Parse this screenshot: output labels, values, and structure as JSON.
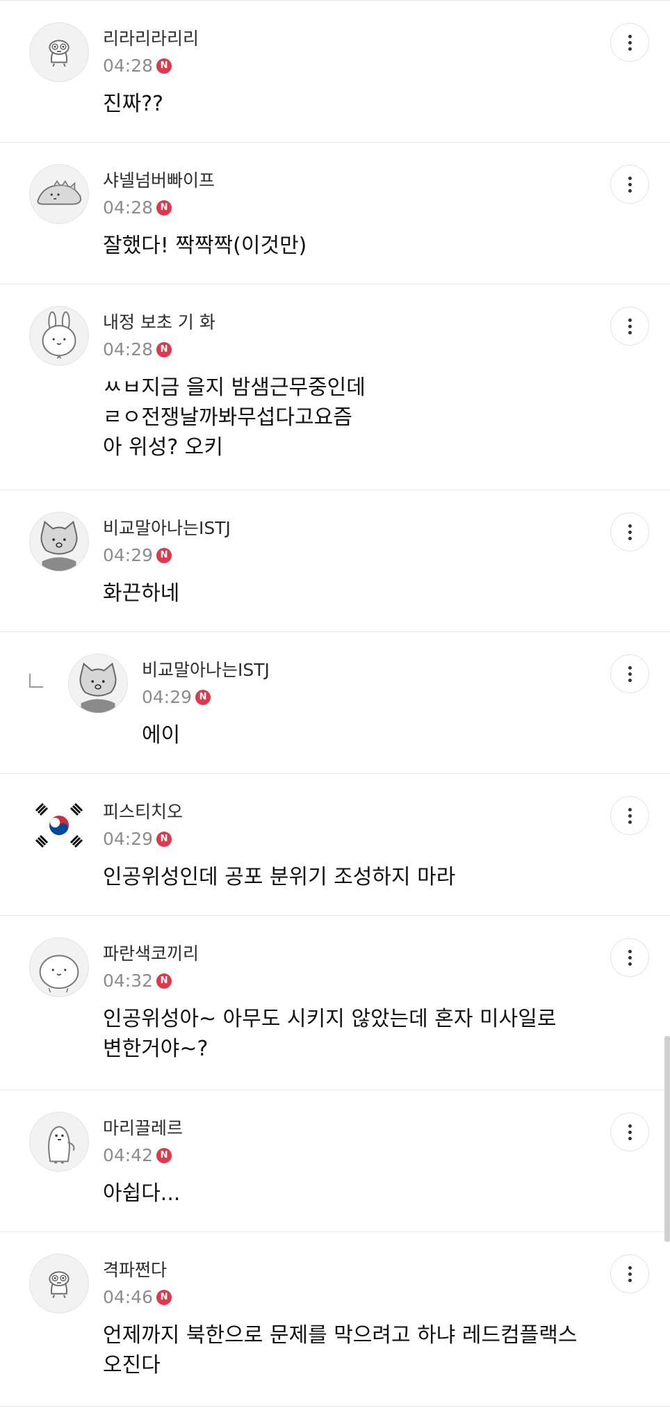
{
  "comments": [
    {
      "nickname": "리라리라리리",
      "time": "04:28",
      "badge": "N",
      "text": "진짜??",
      "avatar": "cartoon-bird-avatar"
    },
    {
      "nickname": "샤넬넘버빠이프",
      "time": "04:28",
      "badge": "N",
      "text": "잘했다! 짝짝짝(이것만)",
      "avatar": "cartoon-dinosaur-avatar"
    },
    {
      "nickname": "내정 보초 기 화",
      "time": "04:28",
      "badge": "N",
      "text": "ㅆㅂ지금 을지 밤샘근무중인데\nㄹㅇ전쟁날까봐무섭다고요즘\n아 위성? 오키",
      "avatar": "cartoon-rabbit-avatar"
    },
    {
      "nickname": "비교말아나는ISTJ",
      "time": "04:29",
      "badge": "N",
      "text": "화끈하네",
      "avatar": "cartoon-cat-avatar"
    },
    {
      "nickname": "비교말아나는ISTJ",
      "time": "04:29",
      "badge": "N",
      "text": "에이",
      "avatar": "cartoon-cat-avatar",
      "reply": true
    },
    {
      "nickname": "피스티치오",
      "time": "04:29",
      "badge": "N",
      "text": "인공위성인데 공포 분위기 조성하지 마라",
      "avatar": "korean-flag-avatar"
    },
    {
      "nickname": "파란색코끼리",
      "time": "04:32",
      "badge": "N",
      "text": "인공위성아~ 아무도 시키지 않았는데 혼자 미사일로\n변한거야~?",
      "avatar": "cartoon-bean-avatar"
    },
    {
      "nickname": "마리끌레르",
      "time": "04:42",
      "badge": "N",
      "text": "아쉽다...",
      "avatar": "cartoon-penguin-avatar"
    },
    {
      "nickname": "격파쩐다",
      "time": "04:46",
      "badge": "N",
      "text": "언제까지 북한으로 문제를 막으려고 하냐 레드컴플랙스\n오진다",
      "avatar": "cartoon-bird-avatar"
    }
  ],
  "menu_icon": "more-vertical-icon",
  "colors": {
    "badge": "#e1374b",
    "time": "#8c8c8c",
    "divider": "#e6e6e6"
  }
}
